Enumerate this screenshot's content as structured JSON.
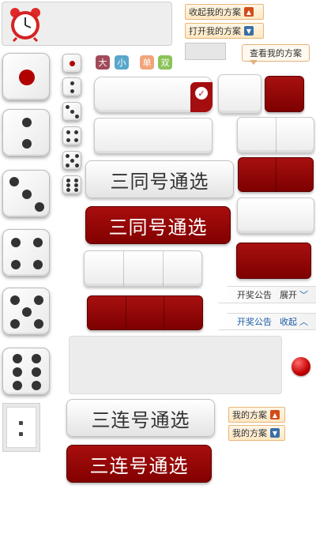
{
  "top_panel": {
    "alarm_icon": "alarm-clock-icon"
  },
  "plan_buttons": {
    "collapse_my_plan": "收起我的方案",
    "open_my_plan": "打开我的方案",
    "view_my_plan": "查看我的方案"
  },
  "filters": {
    "big": "大",
    "small": "小",
    "odd": "单",
    "even": "双",
    "colors": {
      "big": "#a24a5a",
      "small": "#5aa7cc",
      "odd": "#f0a57a",
      "even": "#8bc35a"
    }
  },
  "buttons": {
    "triple_same_select_white": "三同号通选",
    "triple_same_select_red": "三同号通选",
    "triple_consecutive_select_white": "三连号通选",
    "triple_consecutive_select_red": "三连号通选"
  },
  "notices": {
    "collapsed": {
      "label": "开奖公告",
      "toggle": "展开"
    },
    "expanded": {
      "label": "开奖公告",
      "toggle": "收起"
    }
  },
  "my_plan_buttons": {
    "up": "我的方案",
    "down": "我的方案"
  },
  "colors": {
    "accent_red": "#8f0000",
    "tile_white": "#f4f4f4",
    "text_dark": "#333333"
  }
}
